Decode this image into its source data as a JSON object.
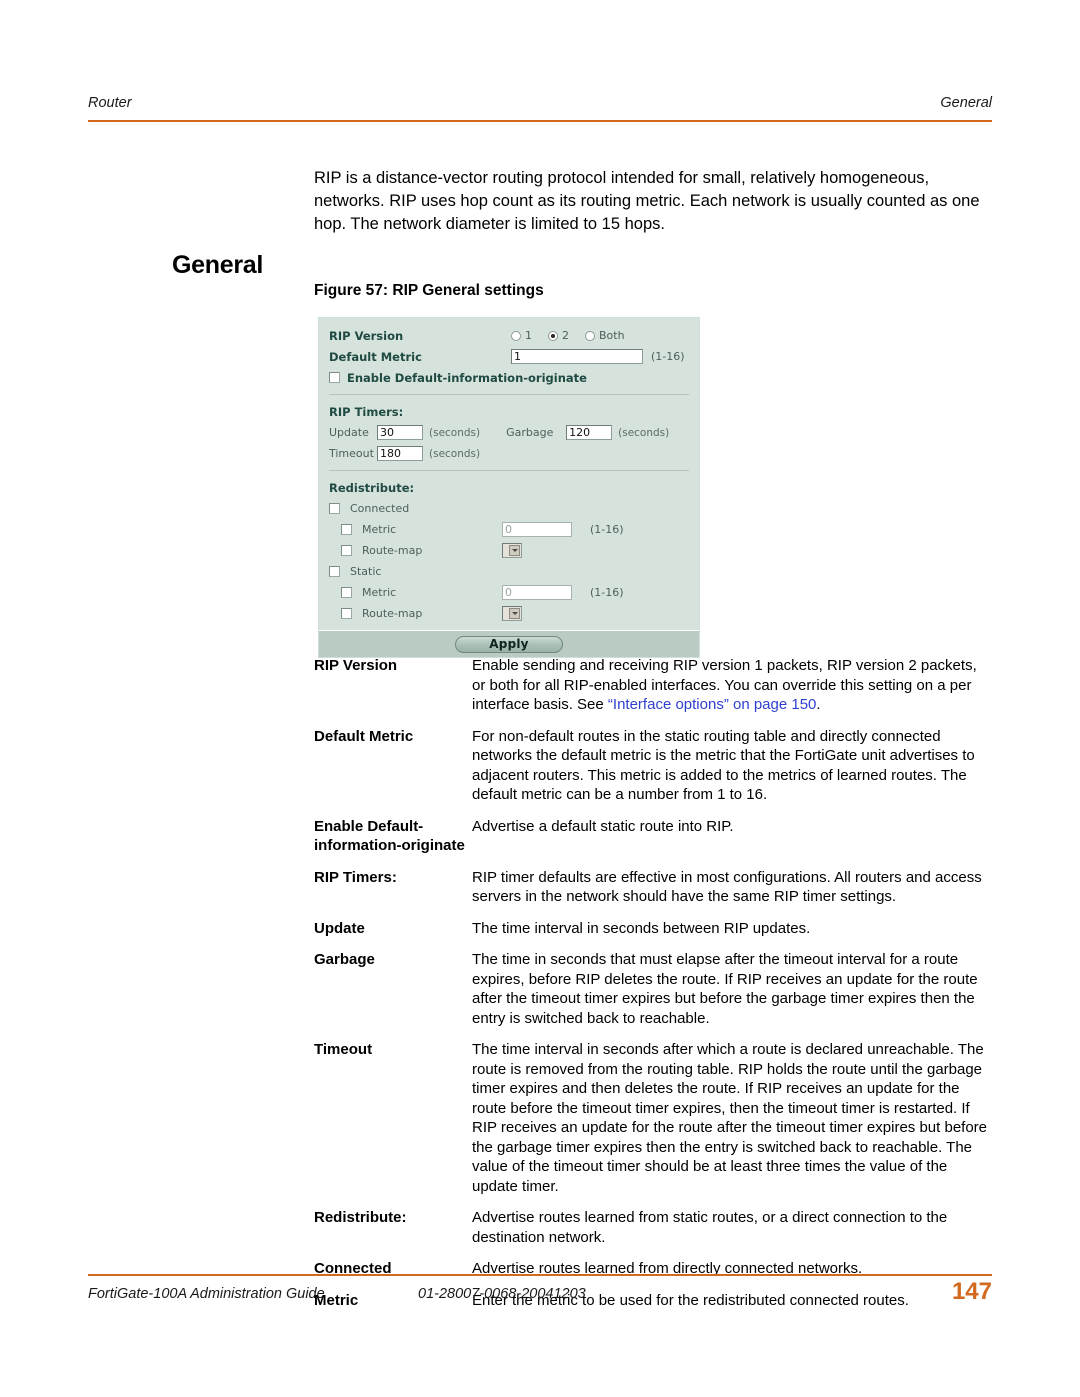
{
  "header": {
    "left": "Router",
    "right": "General"
  },
  "intro": "RIP is a distance-vector routing protocol intended for small, relatively homogeneous, networks. RIP uses hop count as its routing metric. Each network is usually counted as one hop. The network diameter is limited to 15 hops.",
  "section_heading": "General",
  "figure": {
    "caption": "Figure 57: RIP General settings",
    "rip_version": {
      "label": "RIP Version",
      "options": [
        "1",
        "2",
        "Both"
      ],
      "selected": "2"
    },
    "default_metric": {
      "label": "Default Metric",
      "value": "1",
      "range": "(1-16)"
    },
    "default_info_originate": {
      "label": "Enable Default-information-originate",
      "checked": false
    },
    "timers": {
      "title": "RIP Timers:",
      "update": {
        "label": "Update",
        "value": "30",
        "unit": "(seconds)"
      },
      "garbage": {
        "label": "Garbage",
        "value": "120",
        "unit": "(seconds)"
      },
      "timeout": {
        "label": "Timeout",
        "value": "180",
        "unit": "(seconds)"
      }
    },
    "redistribute": {
      "title": "Redistribute:",
      "connected": {
        "label": "Connected",
        "metric": {
          "label": "Metric",
          "value": "0",
          "range": "(1-16)"
        },
        "route_map": {
          "label": "Route-map",
          "value": ""
        }
      },
      "static": {
        "label": "Static",
        "metric": {
          "label": "Metric",
          "value": "0",
          "range": "(1-16)"
        },
        "route_map": {
          "label": "Route-map",
          "value": ""
        }
      }
    },
    "apply_label": "Apply"
  },
  "descriptions": [
    {
      "term": "RIP Version",
      "def_before": "Enable sending and receiving RIP version 1 packets, RIP version 2 packets, or both for all RIP-enabled interfaces. You can override this setting on a per interface basis. See ",
      "link": "“Interface options” on page 150",
      "def_after": "."
    },
    {
      "term": "Default Metric",
      "def": "For non-default routes in the static routing table and directly connected networks the default metric is the metric that the FortiGate unit advertises to adjacent routers. This metric is added to the metrics of learned routes. The default metric can be a number from 1 to 16."
    },
    {
      "term": "Enable Default-information-originate",
      "def": "Advertise a default static route into RIP."
    },
    {
      "term": "RIP Timers:",
      "def": "RIP timer defaults are effective in most configurations. All routers and access servers in the network should have the same RIP timer settings."
    },
    {
      "term": "Update",
      "def": "The time interval in seconds between RIP updates."
    },
    {
      "term": "Garbage",
      "def": "The time in seconds that must elapse after the timeout interval for a route expires, before RIP deletes the route. If RIP receives an update for the route after the timeout timer expires but before the garbage timer expires then the entry is switched back to reachable."
    },
    {
      "term": "Timeout",
      "def": "The time interval in seconds after which a route is declared unreachable. The route is removed from the routing table. RIP holds the route until the garbage timer expires and then deletes the route. If RIP receives an update for the route before the timeout timer expires, then the timeout timer is restarted. If RIP receives an update for the route after the timeout timer expires but before the garbage timer expires then the entry is switched back to reachable. The value of the timeout timer should be at least three times the value of the update timer."
    },
    {
      "term": "Redistribute:",
      "def": "Advertise routes learned from static routes, or a direct connection to the destination network."
    },
    {
      "term": "Connected",
      "def": "Advertise routes learned from directly connected networks."
    },
    {
      "term": "Metric",
      "def": "Enter the metric to be used for the redistributed connected routes."
    }
  ],
  "footer": {
    "guide": "FortiGate-100A Administration Guide",
    "doc_id": "01-28007-0068-20041203",
    "page": "147"
  },
  "colors": {
    "accent": "#d2691e",
    "link": "#2f3fd0",
    "panel_bg": "#d6e3dd",
    "panel_label": "#1f4a42",
    "apply_bar": "#b9cbc3"
  }
}
